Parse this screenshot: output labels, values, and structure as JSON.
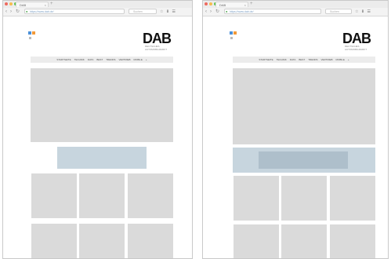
{
  "browser": {
    "tab_title": "DAB",
    "tab_close": "×",
    "new_tab": "+",
    "url": "https://www.dab.de/",
    "search_placeholder": "Suchen",
    "nav": {
      "back": "‹",
      "forward": "›",
      "reload": "↻"
    },
    "toolbar_icons": "☆ ⬇ ☰"
  },
  "site": {
    "brand": "DAB",
    "tagline": "DEUTSCHES AUTOMOBILMARKT",
    "menu": [
      "STARTSEITE",
      "TECHNIK",
      "DATA",
      "BEST",
      "TRENDS",
      "VERTRIEB",
      "MOBILE",
      "+"
    ]
  },
  "colors": {
    "hero_placeholder": "#d9d9d9",
    "banner_placeholder": "#c7d5de",
    "banner_highlight": "#aebfcb",
    "tile_placeholder": "#dadada",
    "logo_blue": "#4a90d9",
    "logo_orange": "#f29a3a"
  },
  "icons": [
    "close-icon",
    "back-arrow-icon",
    "forward-arrow-icon",
    "reload-icon",
    "lock-icon",
    "star-icon",
    "download-icon",
    "menu-icon"
  ]
}
